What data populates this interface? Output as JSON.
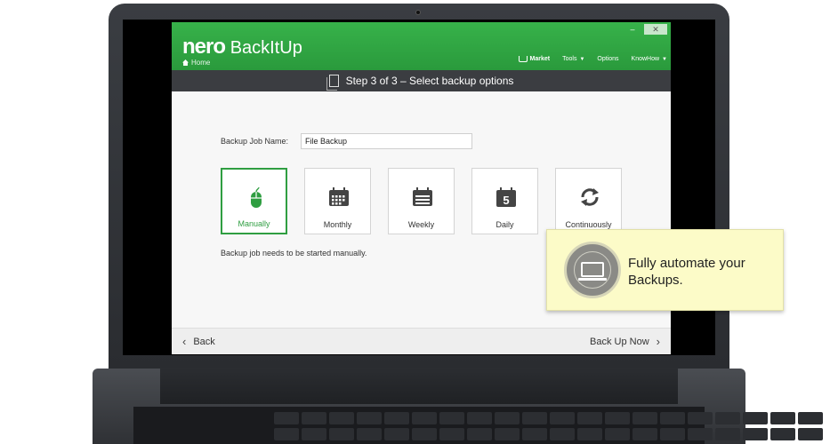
{
  "app": {
    "logo_main": "nero",
    "logo_sub": "BackItUp",
    "home_label": "Home",
    "win_minimize": "–",
    "win_close": "✕"
  },
  "nav": {
    "market": "Market",
    "tools": "Tools",
    "options": "Options",
    "knowhow": "KnowHow"
  },
  "step": {
    "title": "Step 3 of 3 – Select backup options"
  },
  "form": {
    "job_name_label": "Backup Job Name:",
    "job_name_value": "File Backup"
  },
  "schedule_options": [
    {
      "label": "Manually",
      "icon": "mouse-icon",
      "selected": true
    },
    {
      "label": "Monthly",
      "icon": "calendar-month-icon",
      "selected": false
    },
    {
      "label": "Weekly",
      "icon": "calendar-week-icon",
      "selected": false
    },
    {
      "label": "Daily",
      "icon": "calendar-day-icon",
      "selected": false,
      "day_number": "5"
    },
    {
      "label": "Continuously",
      "icon": "refresh-icon",
      "selected": false
    }
  ],
  "description": "Backup job needs to be started manually.",
  "footer": {
    "back_label": "Back",
    "next_label": "Back Up Now"
  },
  "callout": {
    "text": "Fully automate your Backups."
  },
  "colors": {
    "brand_green": "#2f9e41",
    "step_bar": "#3b3d41",
    "callout_bg": "#fcfbc8"
  }
}
